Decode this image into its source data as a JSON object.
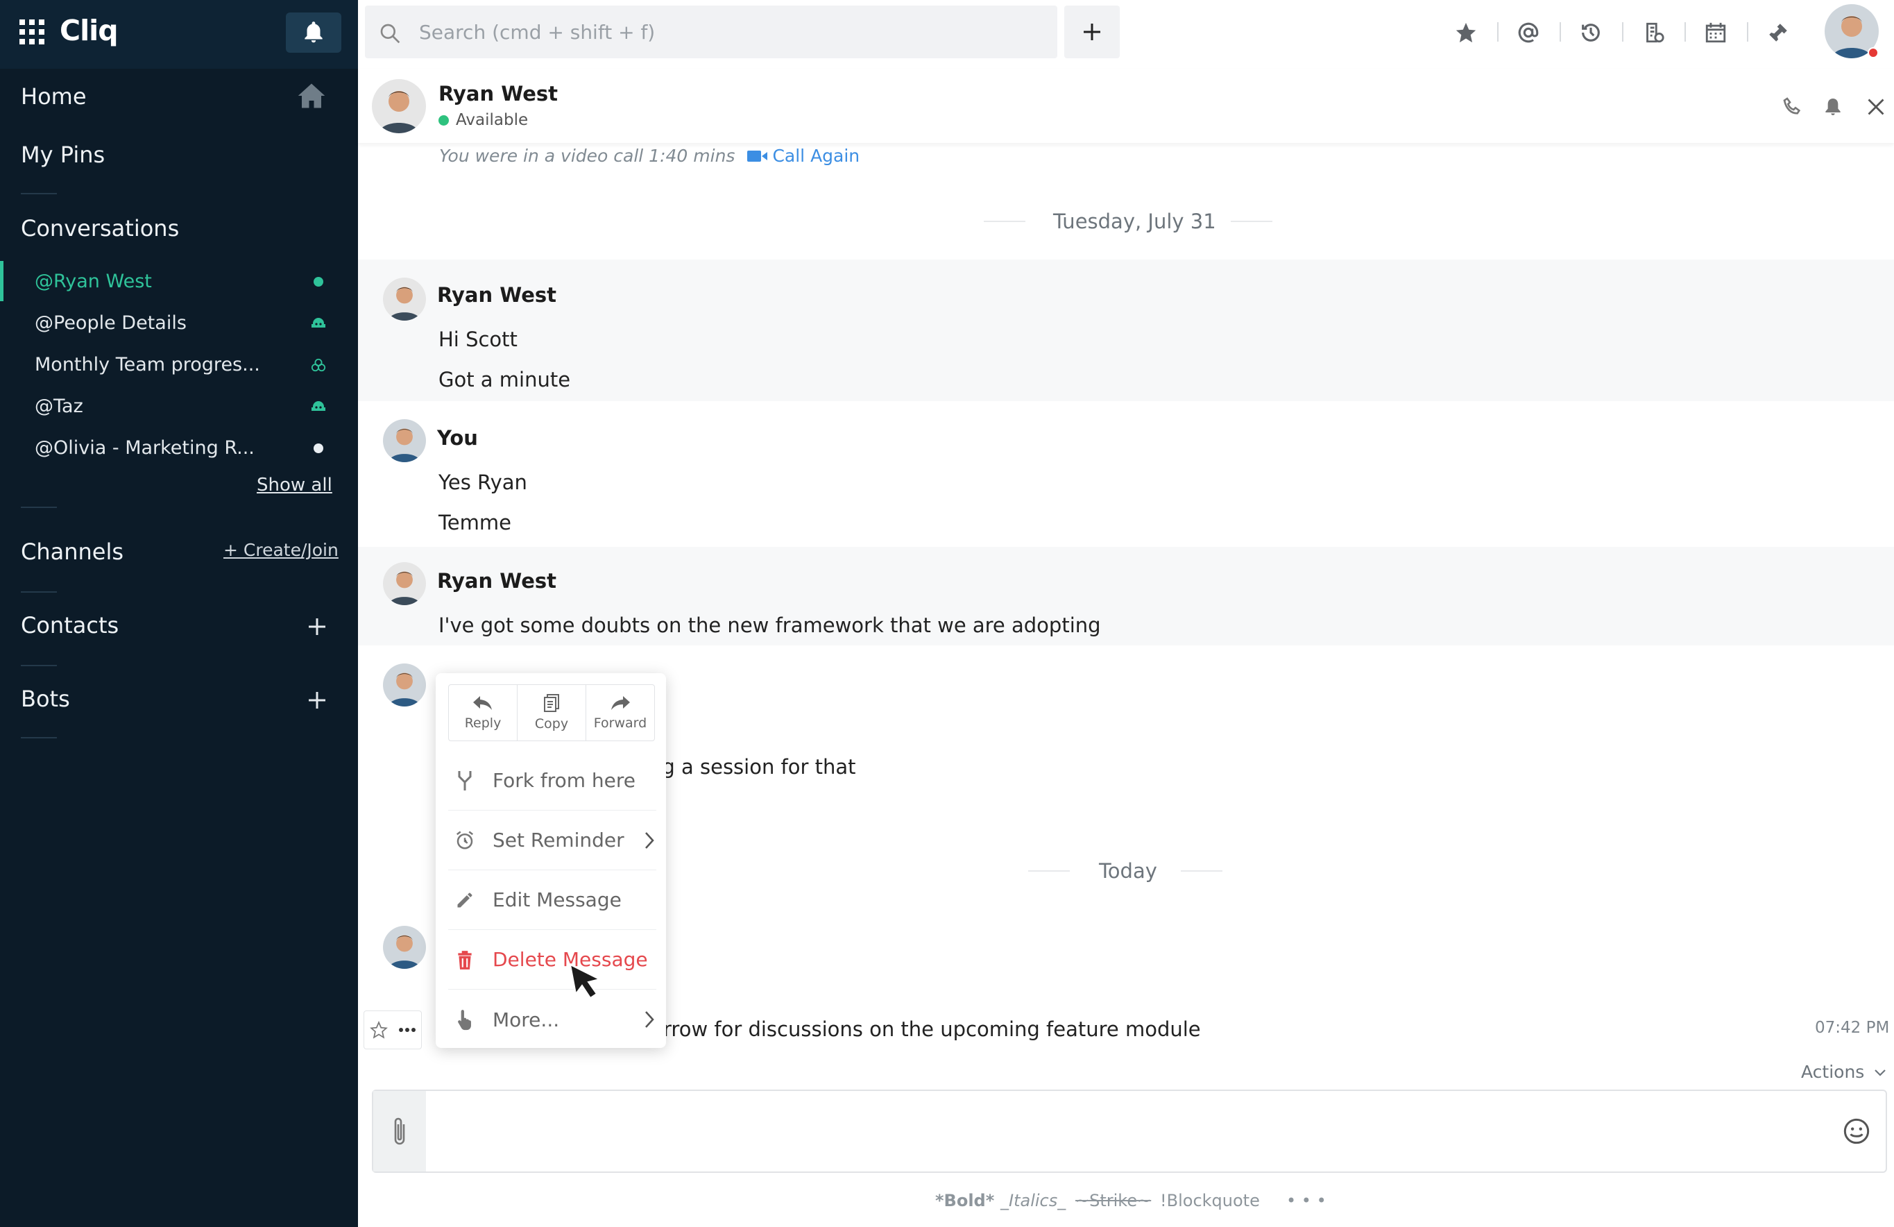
{
  "app": {
    "name": "Cliq"
  },
  "sidebar": {
    "home": "Home",
    "pins": "My Pins",
    "conversations_title": "Conversations",
    "conversations": [
      {
        "label": "@Ryan West",
        "status": "online-dot"
      },
      {
        "label": "@People Details",
        "status": "bot-icon"
      },
      {
        "label": "Monthly Team progres...",
        "status": "group-icon"
      },
      {
        "label": "@Taz",
        "status": "bot-icon"
      },
      {
        "label": "@Olivia - Marketing R...",
        "status": "offline-dot"
      }
    ],
    "show_all": "Show all",
    "channels_title": "Channels",
    "create_join": "+ Create/Join",
    "contacts_title": "Contacts",
    "bots_title": "Bots"
  },
  "topbar": {
    "search_placeholder": "Search (cmd + shift + f)"
  },
  "chat": {
    "contact_name": "Ryan West",
    "contact_status": "Available",
    "call_info": "You were in a video call  1:40 mins",
    "call_again": "Call Again",
    "date_tuesday": "Tuesday, July 31",
    "date_today": "Today",
    "messages": [
      {
        "sender": "Ryan West",
        "lines": [
          "Hi Scott",
          "Got a minute"
        ]
      },
      {
        "sender": "You",
        "lines": [
          "Yes Ryan",
          "Temme"
        ]
      },
      {
        "sender": "Ryan West",
        "lines": [
          "I've got some doubts on the new framework that we are adopting"
        ]
      },
      {
        "sender": "",
        "lines": [
          "ng a session for that"
        ]
      },
      {
        "sender": "",
        "lines": [
          "rrow for discussions on the upcoming feature module"
        ],
        "time": "07:42 PM"
      }
    ],
    "actions": "Actions"
  },
  "context_menu": {
    "quick": [
      "Reply",
      "Copy",
      "Forward"
    ],
    "items": [
      "Fork from here",
      "Set Reminder",
      "Edit Message",
      "Delete Message",
      "More..."
    ]
  },
  "format_bar": {
    "bold": "*Bold*",
    "italics": "_Italics_",
    "strike": "~Strike~",
    "blockquote": "!Blockquote",
    "more": "• • •"
  },
  "colors": {
    "sidebar": "#0c1b28",
    "accent": "#2fc39a",
    "danger": "#e5484d",
    "link": "#3c8ee3"
  }
}
